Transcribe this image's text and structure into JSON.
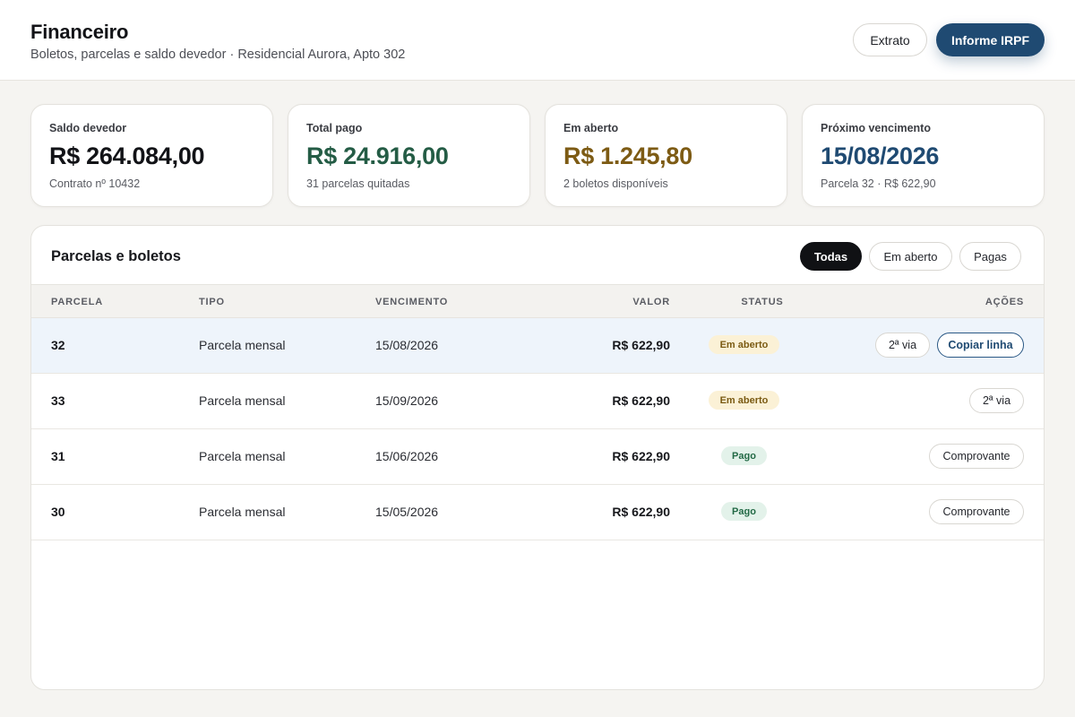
{
  "header": {
    "title": "Financeiro",
    "subtitle": "Boletos, parcelas e saldo devedor · Residencial Aurora, Apto 302",
    "extrato_label": "Extrato",
    "irpf_label": "Informe IRPF"
  },
  "summary": [
    {
      "label": "Saldo devedor",
      "value": "R$ 264.084,00",
      "sub": "Contrato nº 10432",
      "color": "#121317"
    },
    {
      "label": "Total pago",
      "value": "R$ 24.916,00",
      "sub": "31 parcelas quitadas",
      "color": "#245c45"
    },
    {
      "label": "Em aberto",
      "value": "R$ 1.245,80",
      "sub": "2 boletos disponíveis",
      "color": "#7d5b14"
    },
    {
      "label": "Próximo vencimento",
      "value": "15/08/2026",
      "sub": "Parcela 32 · R$ 622,90",
      "color": "#1f4a72"
    }
  ],
  "panel": {
    "title": "Parcelas e boletos",
    "filters": [
      "Todas",
      "Em aberto",
      "Pagas"
    ],
    "active_filter": "Todas"
  },
  "table": {
    "columns": [
      "PARCELA",
      "TIPO",
      "VENCIMENTO",
      "VALOR",
      "STATUS",
      "AÇÕES"
    ],
    "rows": [
      {
        "parcela": "32",
        "tipo": "Parcela mensal",
        "vencimento": "15/08/2026",
        "valor": "R$ 622,90",
        "status": "Em aberto",
        "actions": [
          "2ª via",
          "Copiar linha"
        ]
      },
      {
        "parcela": "33",
        "tipo": "Parcela mensal",
        "vencimento": "15/09/2026",
        "valor": "R$ 622,90",
        "status": "Em aberto",
        "actions": [
          "2ª via"
        ]
      },
      {
        "parcela": "31",
        "tipo": "Parcela mensal",
        "vencimento": "15/06/2026",
        "valor": "R$ 622,90",
        "status": "Pago",
        "actions": [
          "Comprovante"
        ]
      },
      {
        "parcela": "30",
        "tipo": "Parcela mensal",
        "vencimento": "15/05/2026",
        "valor": "R$ 622,90",
        "status": "Pago",
        "actions": [
          "Comprovante"
        ]
      }
    ]
  },
  "colors": {
    "primary": "#1f4a72",
    "open_badge_bg": "#fbf1d6",
    "paid_badge_bg": "#e3f2ea",
    "row_highlight": "#eef4fb"
  }
}
